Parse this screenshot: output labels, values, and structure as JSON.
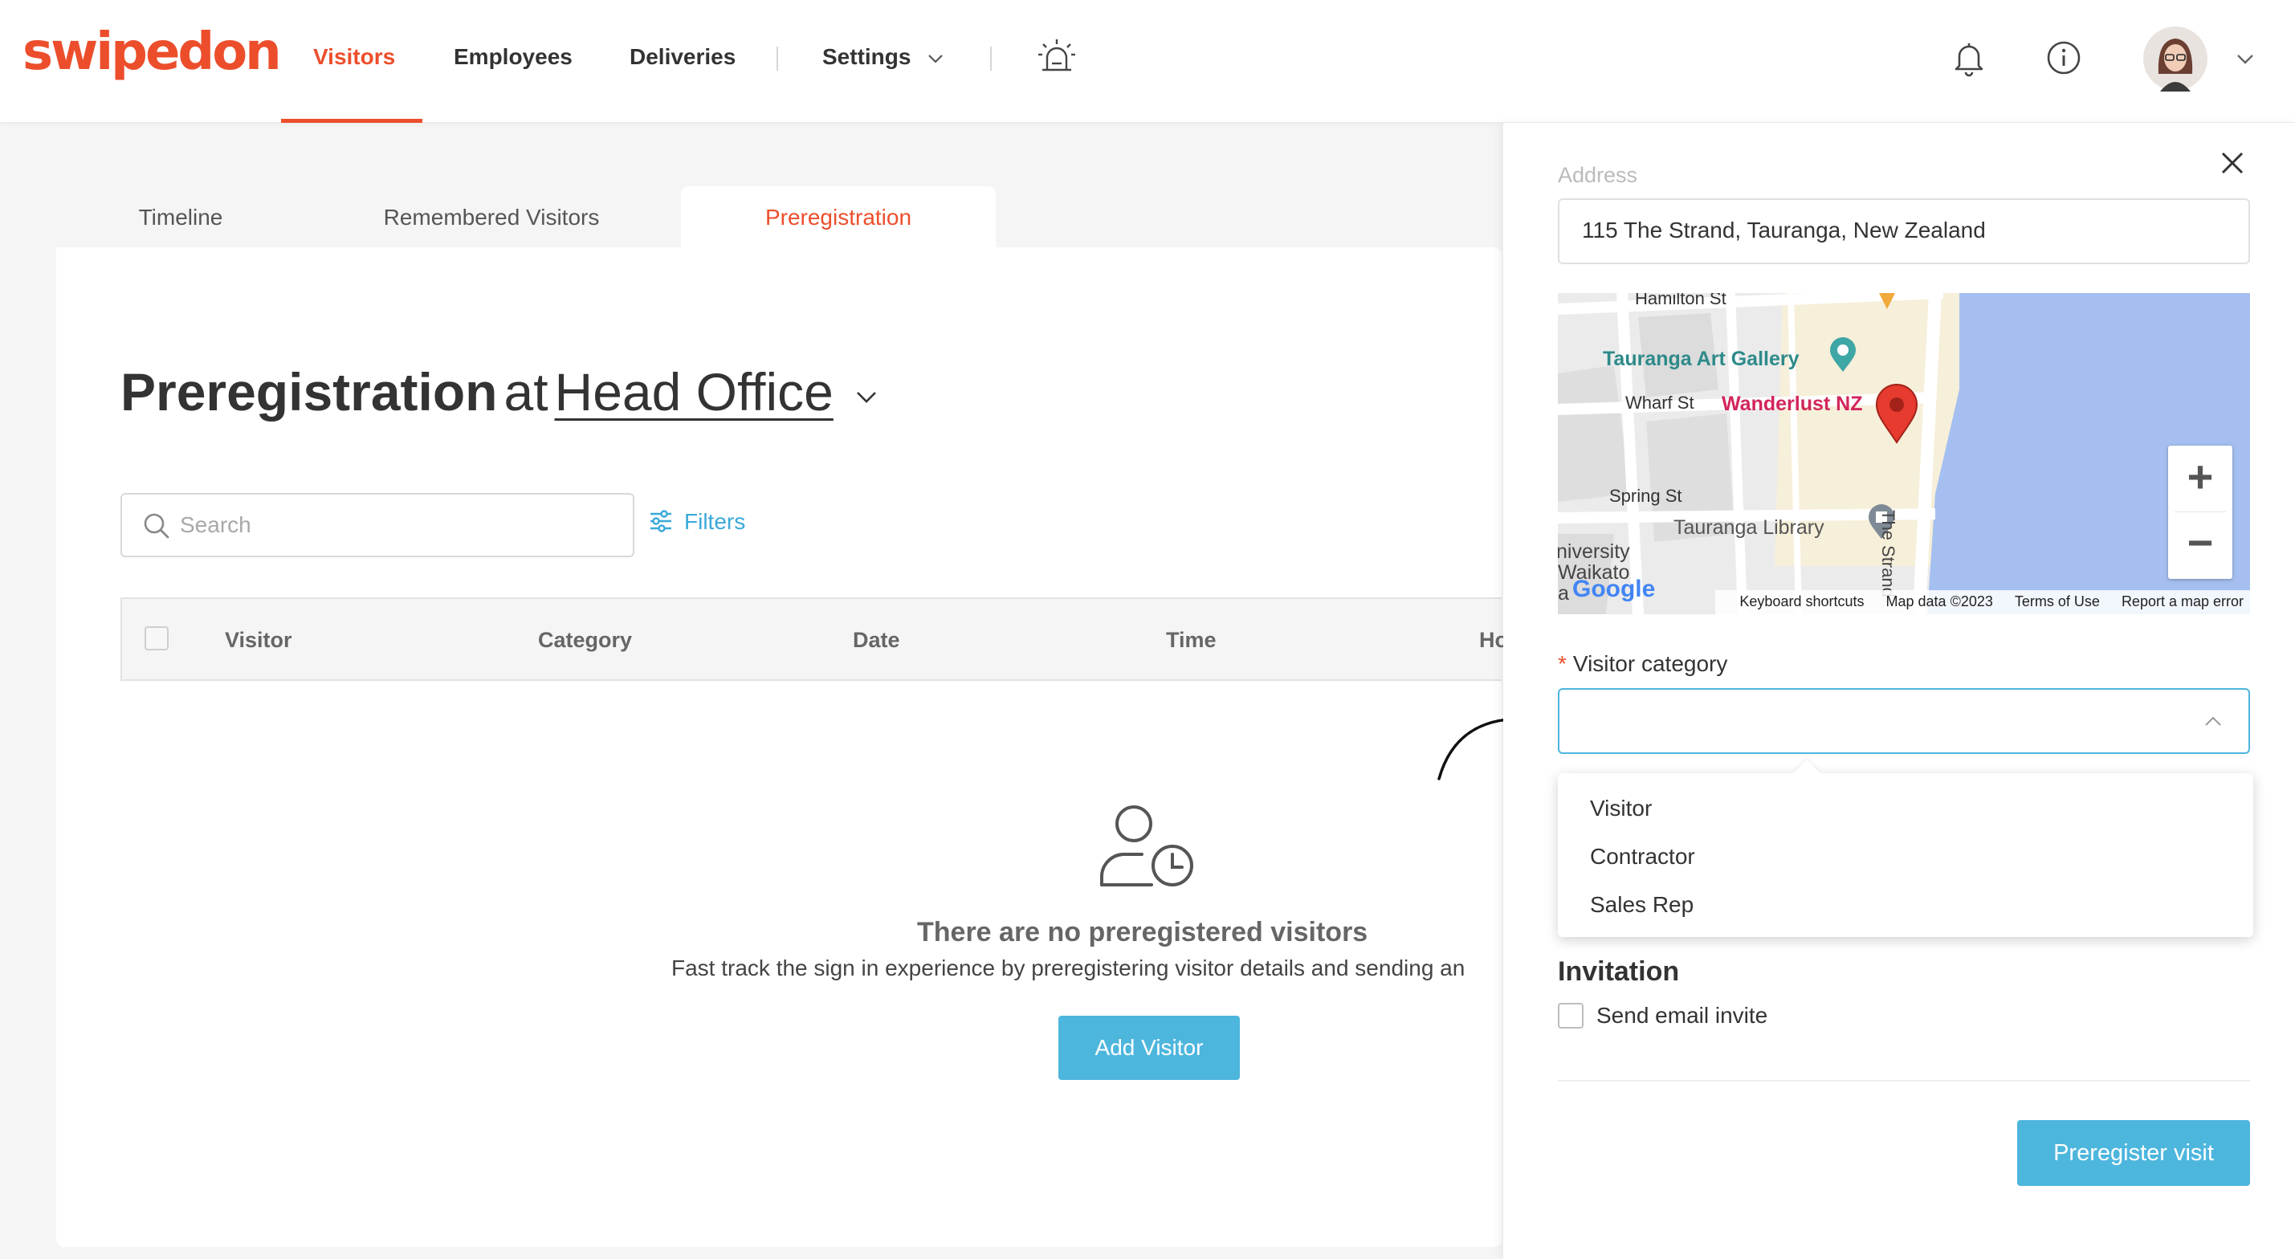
{
  "brand": {
    "logo_text": "swipedon",
    "accent": "#ec4e2c",
    "primary_button": "#4db6dd"
  },
  "nav": {
    "items": [
      {
        "label": "Visitors",
        "active": true
      },
      {
        "label": "Employees",
        "active": false
      },
      {
        "label": "Deliveries",
        "active": false
      },
      {
        "label": "Settings",
        "active": false
      }
    ],
    "icons": [
      "emergency-alarm-icon",
      "bell-icon",
      "info-icon",
      "avatar",
      "chevron-down-icon"
    ]
  },
  "tabs": [
    {
      "label": "Timeline",
      "active": false
    },
    {
      "label": "Remembered Visitors",
      "active": false
    },
    {
      "label": "Preregistration",
      "active": true
    }
  ],
  "page": {
    "title": "Preregistration",
    "at": "at",
    "location": "Head Office"
  },
  "search": {
    "placeholder": "Search",
    "filters_label": "Filters"
  },
  "table": {
    "columns": [
      "Visitor",
      "Category",
      "Date",
      "Time",
      "Ho"
    ]
  },
  "empty_state": {
    "title": "There are no preregistered visitors",
    "description": "Fast track the sign in experience by preregistering visitor details and sending an",
    "button": "Add Visitor"
  },
  "panel": {
    "cut_label": "Address",
    "address_value": "115 The Strand, Tauranga, New Zealand",
    "map": {
      "streets": [
        "Hamilton St",
        "Wharf St",
        "Spring St",
        "The Strand"
      ],
      "places": [
        "Tauranga Art Gallery",
        "Wanderlust NZ",
        "Tauranga Library",
        "niversity",
        "Waikato",
        "a"
      ],
      "attribution": [
        "Google",
        "Keyboard shortcuts",
        "Map data ©2023",
        "Terms of Use",
        "Report a map error"
      ],
      "zoom_in": "+",
      "zoom_out": "−"
    },
    "category_label": "Visitor category",
    "required_mark": "*",
    "category_value": "",
    "category_options": [
      "Visitor",
      "Contractor",
      "Sales Rep"
    ],
    "invitation_title": "Invitation",
    "send_email_label": "Send email invite",
    "send_email_checked": false,
    "submit_label": "Preregister visit"
  }
}
